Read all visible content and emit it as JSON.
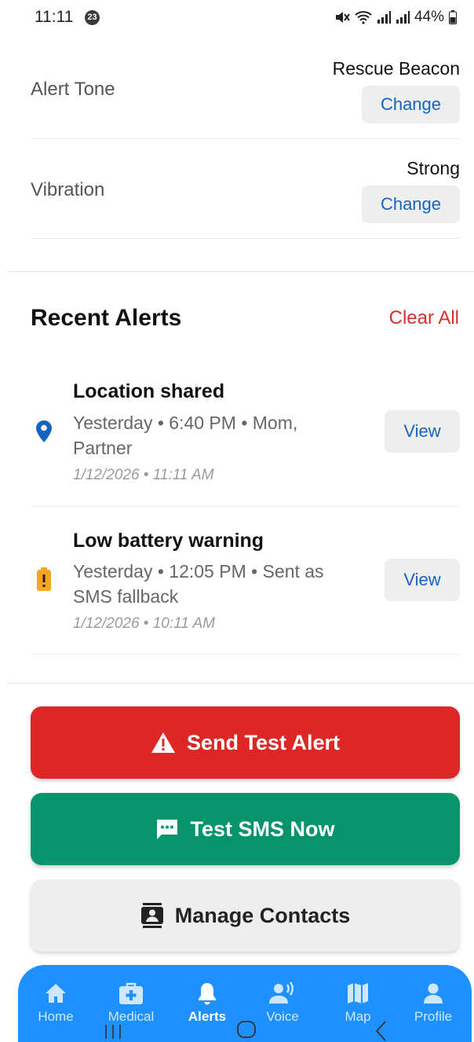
{
  "status_bar": {
    "time": "11:11",
    "notification_count": "23",
    "battery": "44%"
  },
  "settings": [
    {
      "label": "Alert Tone",
      "value": "Rescue Beacon",
      "button": "Change"
    },
    {
      "label": "Vibration",
      "value": "Strong",
      "button": "Change"
    }
  ],
  "recent_alerts": {
    "title": "Recent Alerts",
    "clear_label": "Clear All",
    "items": [
      {
        "icon": "location-pin-icon",
        "title": "Location shared",
        "desc": "Yesterday • 6:40 PM • Mom, Partner",
        "time": "1/12/2026 • 11:11 AM",
        "button": "View"
      },
      {
        "icon": "low-battery-icon",
        "title": "Low battery warning",
        "desc": "Yesterday • 12:05 PM • Sent as SMS fallback",
        "time": "1/12/2026 • 10:11 AM",
        "button": "View"
      }
    ]
  },
  "actions": {
    "send_test_alert": "Send Test Alert",
    "test_sms": "Test SMS Now",
    "manage_contacts": "Manage Contacts"
  },
  "nav": {
    "items": [
      {
        "label": "Home",
        "icon": "home-icon"
      },
      {
        "label": "Medical",
        "icon": "medical-kit-icon"
      },
      {
        "label": "Alerts",
        "icon": "bell-icon",
        "active": true
      },
      {
        "label": "Voice",
        "icon": "voice-icon"
      },
      {
        "label": "Map",
        "icon": "map-icon"
      },
      {
        "label": "Profile",
        "icon": "profile-icon"
      }
    ]
  },
  "colors": {
    "accent_blue": "#1e90ff",
    "link_blue": "#1565c0",
    "danger_red": "#dd2626",
    "success_green": "#06956b",
    "clear_red": "#d32f2f",
    "location_blue": "#1565c0",
    "battery_amber": "#f5a623"
  }
}
